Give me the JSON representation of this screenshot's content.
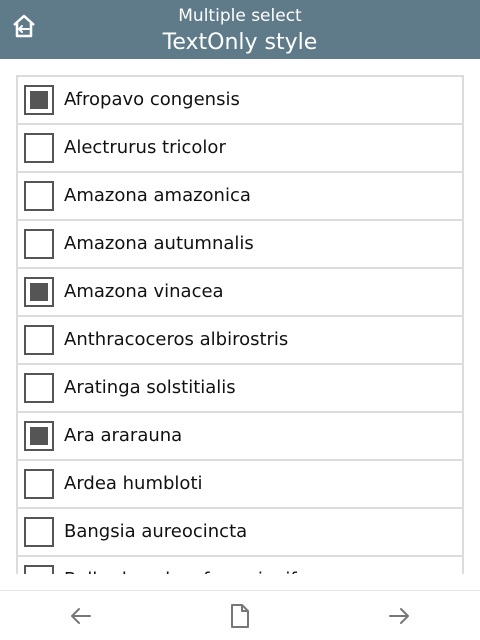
{
  "header": {
    "home_icon": "home-back-icon",
    "title_small": "Multiple select",
    "title_large": "TextOnly style"
  },
  "list": {
    "items": [
      {
        "label": "Afropavo congensis",
        "checked": true
      },
      {
        "label": "Alectrurus tricolor",
        "checked": false
      },
      {
        "label": "Amazona amazonica",
        "checked": false
      },
      {
        "label": "Amazona autumnalis",
        "checked": false
      },
      {
        "label": "Amazona vinacea",
        "checked": true
      },
      {
        "label": "Anthracoceros albirostris",
        "checked": false
      },
      {
        "label": "Aratinga solstitialis",
        "checked": false
      },
      {
        "label": "Ara ararauna",
        "checked": true
      },
      {
        "label": "Ardea humbloti",
        "checked": false
      },
      {
        "label": "Bangsia aureocincta",
        "checked": false
      },
      {
        "label": "Bolborhynchus ferrugineifrons",
        "checked": false
      }
    ]
  },
  "footer": {
    "back_icon": "arrow-left-icon",
    "page_icon": "page-icon",
    "forward_icon": "arrow-right-icon"
  },
  "colors": {
    "header_bg": "#5f7b8a",
    "checkbox": "#555555",
    "divider": "#dcdcdc"
  }
}
